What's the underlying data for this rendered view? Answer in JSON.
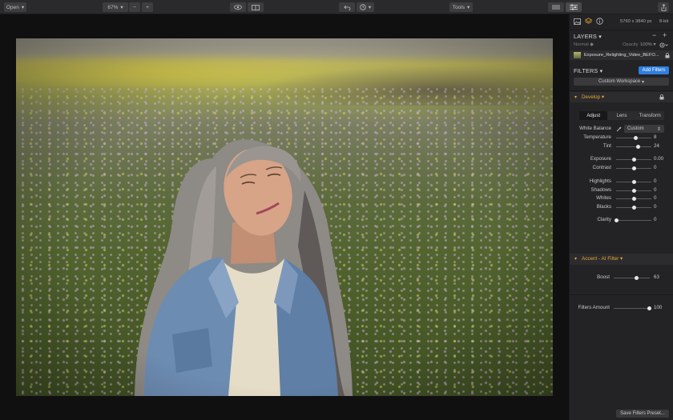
{
  "toolbar": {
    "open_label": "Open",
    "zoom_label": "67%",
    "tools_label": "Tools"
  },
  "panel": {
    "image_info": "5760 x 3840 px",
    "bit_depth": "8-bit",
    "layers_title": "LAYERS",
    "blend_mode": "Normal",
    "opacity_label": "Opacity",
    "opacity_value": "100%",
    "layer_name": "Exposure_Relighting_Video_BEFO...",
    "filters_title": "FILTERS",
    "add_filters_label": "Add Filters",
    "workspace_label": "Custom Workspace",
    "develop": {
      "title": "Develop",
      "tabs": [
        "Adjust",
        "Lens",
        "Transform"
      ],
      "white_balance_label": "White Balance",
      "white_balance_value": "Custom",
      "sliders": [
        {
          "label": "Temperature",
          "value": "8",
          "pos": 0.55
        },
        {
          "label": "Tint",
          "value": "24",
          "pos": 0.62
        },
        {
          "label": "Exposure",
          "value": "0.00",
          "pos": 0.5
        },
        {
          "label": "Contrast",
          "value": "0",
          "pos": 0.5
        },
        {
          "label": "Highlights",
          "value": "0",
          "pos": 0.5
        },
        {
          "label": "Shadows",
          "value": "0",
          "pos": 0.5
        },
        {
          "label": "Whites",
          "value": "0",
          "pos": 0.5
        },
        {
          "label": "Blacks",
          "value": "0",
          "pos": 0.5
        },
        {
          "label": "Clarity",
          "value": "0",
          "pos": 0.0
        }
      ]
    },
    "accent": {
      "title": "Accent - AI Filter",
      "boost_label": "Boost",
      "boost_value": "63",
      "boost_pos": 0.63
    },
    "filters_amount_label": "Filters Amount",
    "filters_amount_value": "100",
    "filters_amount_pos": 1.0,
    "save_preset_label": "Save Filters Preset..."
  },
  "colors": {
    "accent_blue": "#2f7fe0",
    "section_orange": "#e8a530",
    "panel_bg": "#232325"
  }
}
